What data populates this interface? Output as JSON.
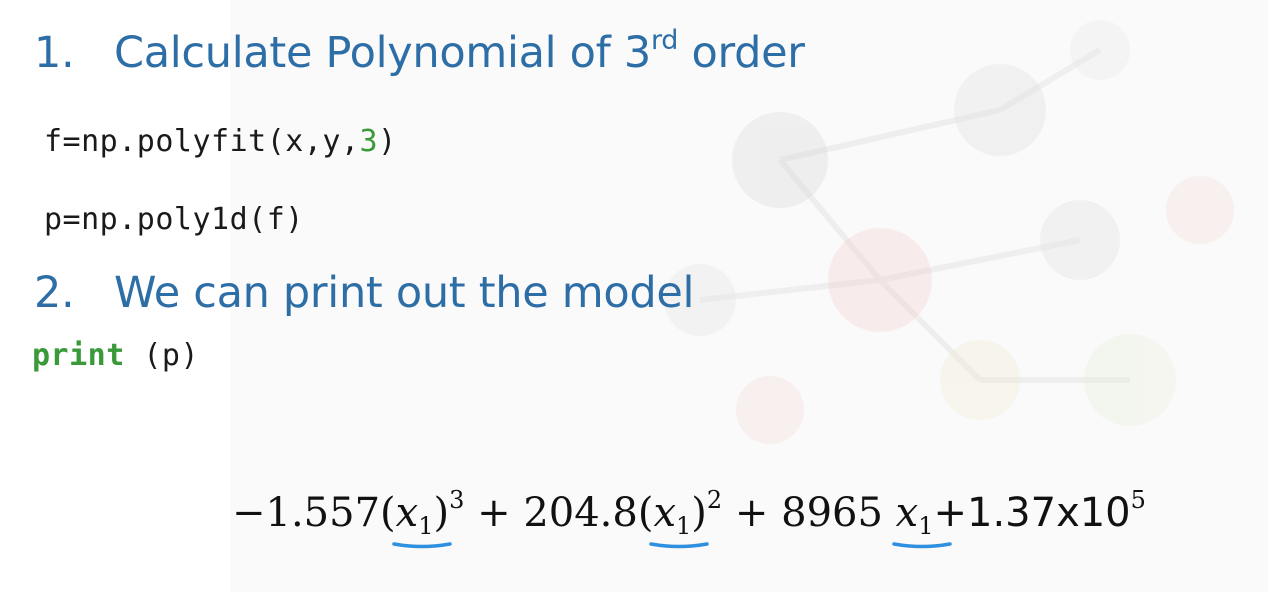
{
  "slide": {
    "step1": {
      "number": "1.",
      "text": "Calculate Polynomial of 3",
      "superscript": "rd",
      "text_after": " order"
    },
    "code_line1": {
      "prefix": "f=np.polyfit(x,y,",
      "number": "3",
      "suffix": ")"
    },
    "code_line2": {
      "text": "p=np.poly1d(f)"
    },
    "step2": {
      "number": "2.",
      "text": "We can print out the model"
    },
    "code_line3": {
      "keyword": "print",
      "args": " (p)"
    },
    "equation": {
      "coef1": "−1.557(",
      "var1": "x",
      "sub1": "1",
      "close1": ")",
      "pow1": "3",
      "coef2": " + 204.8(",
      "var2": "x",
      "sub2": "1",
      "close2": ")",
      "pow2": "2",
      "coef3": " + 8965 ",
      "var3": "x",
      "sub3": "1",
      "const": "+1.37x10",
      "const_pow": "5"
    },
    "colors": {
      "heading": "#2e6ea6",
      "keyword": "#3a9a3a",
      "underline": "#2f8fe0"
    }
  }
}
